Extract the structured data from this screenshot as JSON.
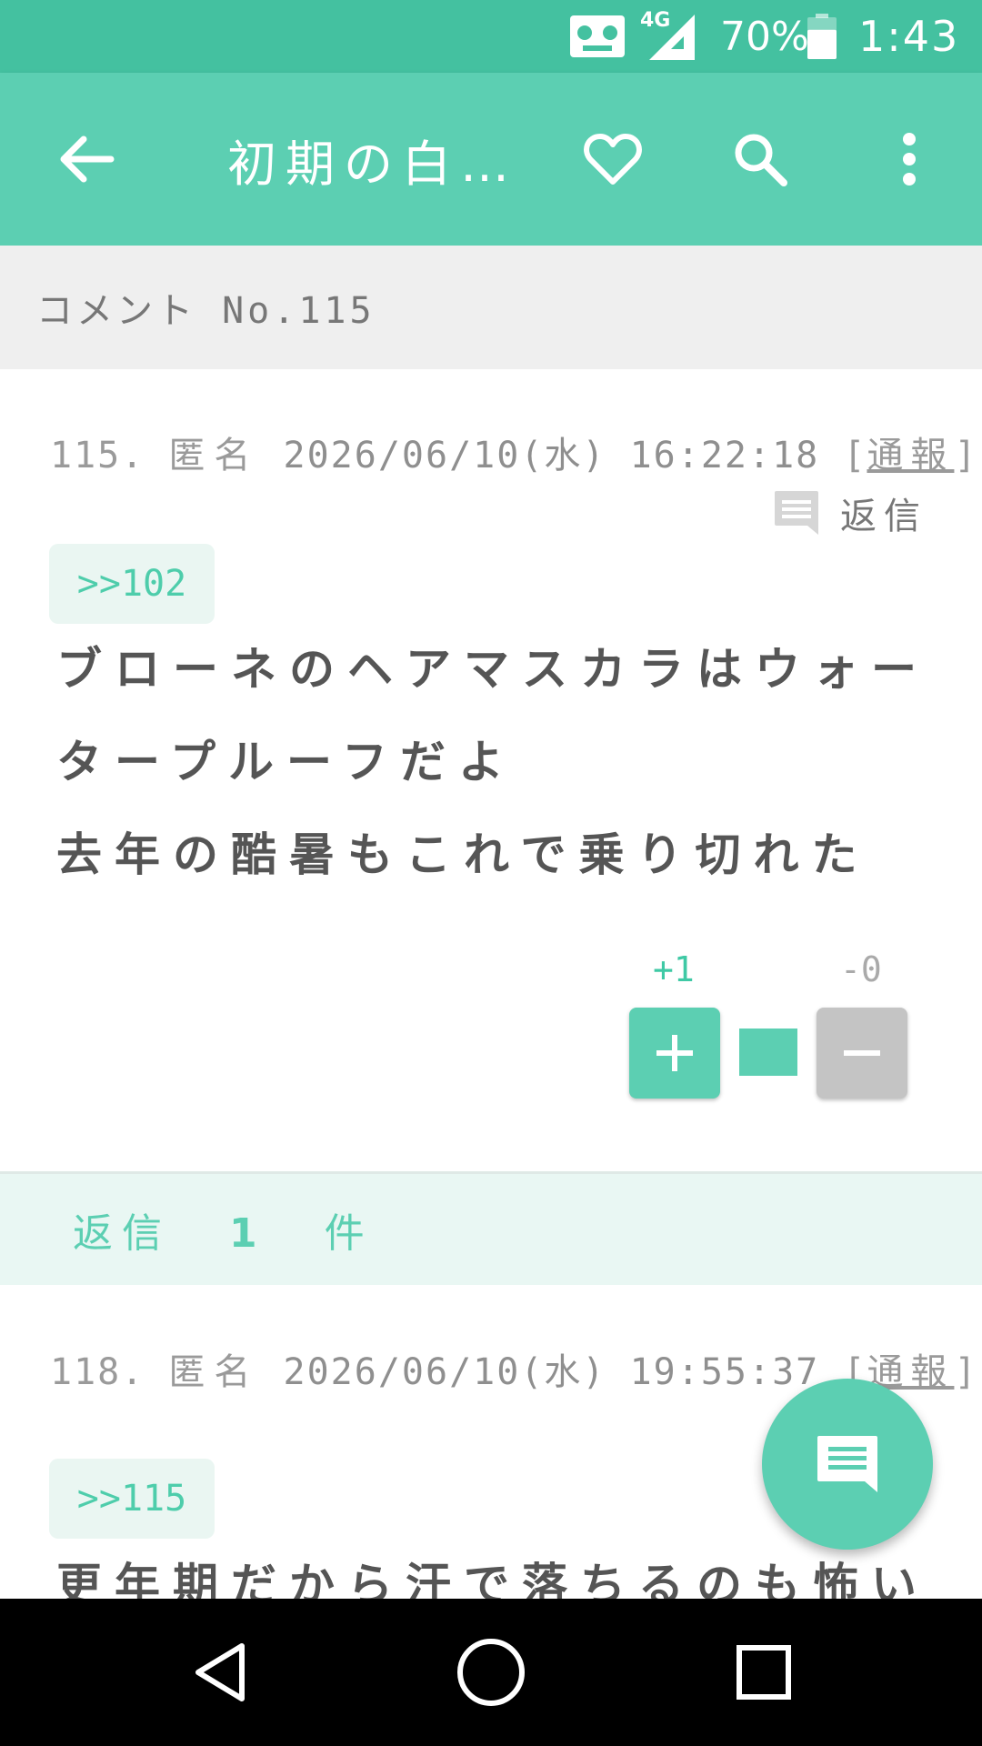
{
  "status_bar": {
    "network": "4G",
    "battery": "70%",
    "battery_level": 0.7,
    "time": "1:43"
  },
  "app_bar": {
    "title": "初期の白…",
    "icons": [
      "back-arrow-icon",
      "heart-icon",
      "search-icon",
      "more-vert-icon"
    ]
  },
  "section": {
    "heading": "コメント No.115"
  },
  "comment": {
    "number": "115.",
    "author": "匿名",
    "datetime": "2026/06/10(水) 16:22:18",
    "report_open": "[",
    "report_label": "通報",
    "report_close": "]",
    "reply_label": "返信",
    "anchor": ">>102",
    "lines": [
      "ブローネのヘアマスカラはウォー",
      "タープルーフだよ",
      "去年の酷暑もこれで乗り切れた"
    ],
    "plus_count": "+1",
    "minus_count": "-0",
    "plus_ratio": 1.0
  },
  "replies": {
    "heading": "返信",
    "count": "1",
    "unit": "件"
  },
  "reply": {
    "number": "118.",
    "author": "匿名",
    "datetime": "2026/06/10(水) 19:55:37",
    "report_open": "[",
    "report_label": "通報",
    "report_close": "]",
    "anchor": ">>115",
    "first_line": "更年期だから汗で落ちるのも怖い"
  },
  "colors": {
    "status_bar": "#44c1a0",
    "app_bar": "#5ccfb2",
    "accent": "#5ccfb2",
    "anchor_bg": "#eaf6f2",
    "minus_button": "#c4c4c4"
  }
}
